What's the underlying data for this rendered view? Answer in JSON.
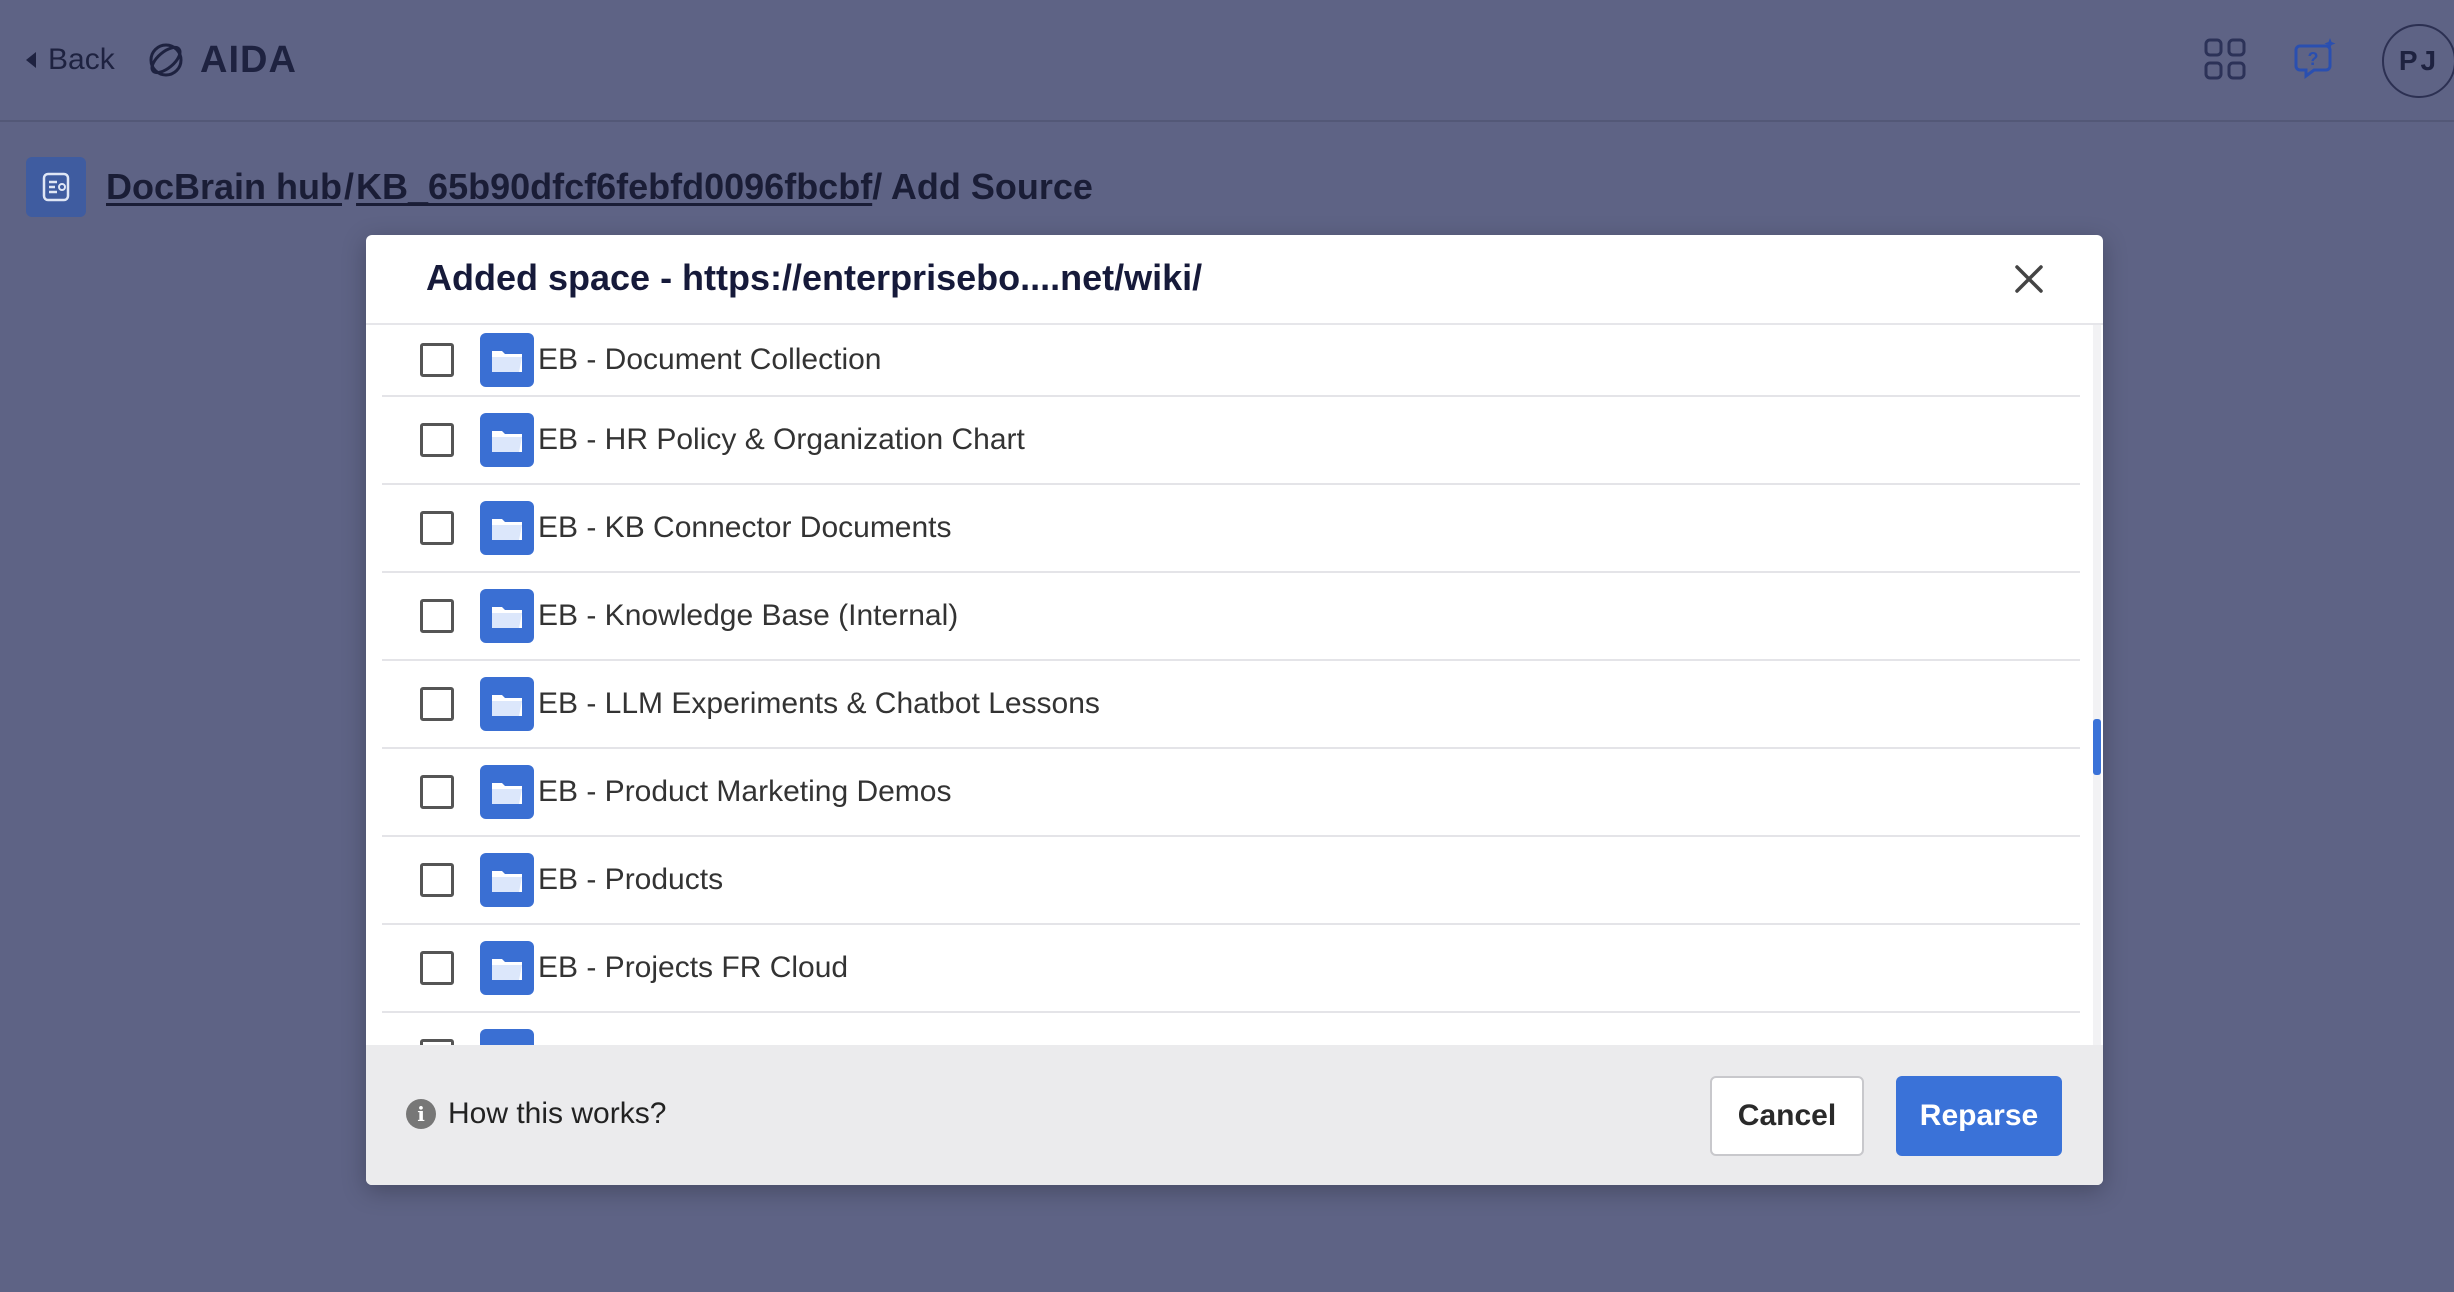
{
  "topbar": {
    "back_label": "Back",
    "app_name": "AIDA",
    "avatar_initials": "PJ"
  },
  "breadcrumb": {
    "items": [
      "DocBrain hub",
      "KB_65b90dfcf6febfd0096fbcbf"
    ],
    "separator": "/",
    "current": "/ Add Source"
  },
  "modal": {
    "title": "Added space - https://enterprisebo....net/wiki/",
    "rows": [
      {
        "label": "EB - Document Collection",
        "checked": false
      },
      {
        "label": "EB - HR Policy & Organization Chart",
        "checked": false
      },
      {
        "label": "EB - KB Connector Documents",
        "checked": false
      },
      {
        "label": "EB - Knowledge Base (Internal)",
        "checked": false
      },
      {
        "label": "EB - LLM Experiments & Chatbot Lessons",
        "checked": false
      },
      {
        "label": "EB - Product Marketing Demos",
        "checked": false
      },
      {
        "label": "EB - Products",
        "checked": false
      },
      {
        "label": "EB - Projects FR Cloud",
        "checked": false
      },
      {
        "label": "",
        "checked": false
      }
    ],
    "footer": {
      "how_label": "How this works?",
      "cancel_label": "Cancel",
      "reparse_label": "Reparse"
    }
  },
  "colors": {
    "backdrop": "#5e6385",
    "accent": "#3a72d8",
    "folder": "#3a6fd3"
  }
}
